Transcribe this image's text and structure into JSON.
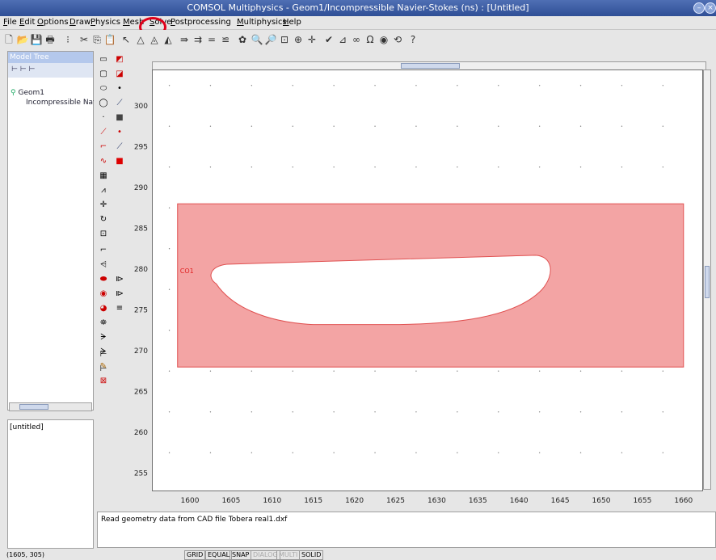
{
  "window": {
    "title": "COMSOL Multiphysics - Geom1/Incompressible Navier-Stokes (ns) : [Untitled]"
  },
  "menu": [
    "File",
    "Edit",
    "Options",
    "Draw",
    "Physics",
    "Mesh",
    "Solve",
    "Postprocessing",
    "Multiphysics",
    "Help"
  ],
  "model_tree": {
    "header": "Model Tree",
    "root": "Geom1",
    "child": "Incompressible Nav"
  },
  "properties": {
    "text": "[untitled]"
  },
  "status_message": "Read geometry data from CAD file Tobera real1.dxf",
  "coords": "(1605, 305)",
  "status_buttons": [
    {
      "label": "GRID",
      "enabled": true
    },
    {
      "label": "EQUAL",
      "enabled": true
    },
    {
      "label": "SNAP",
      "enabled": true
    },
    {
      "label": "DIALOG",
      "enabled": false
    },
    {
      "label": "MULTI",
      "enabled": false
    },
    {
      "label": "SOLID",
      "enabled": true
    }
  ],
  "geometry_label": "CO1",
  "axes": {
    "x_ticks": [
      "1600",
      "1605",
      "1610",
      "1615",
      "1620",
      "1625",
      "1630",
      "1635",
      "1640",
      "1645",
      "1650",
      "1655",
      "1660"
    ],
    "y_ticks": [
      "300",
      "295",
      "290",
      "285",
      "280",
      "275",
      "270",
      "265",
      "260",
      "255"
    ]
  },
  "colors": {
    "fill": "#f3a4a4",
    "stroke": "#e05050",
    "highlight_circle": "#e0001a"
  }
}
